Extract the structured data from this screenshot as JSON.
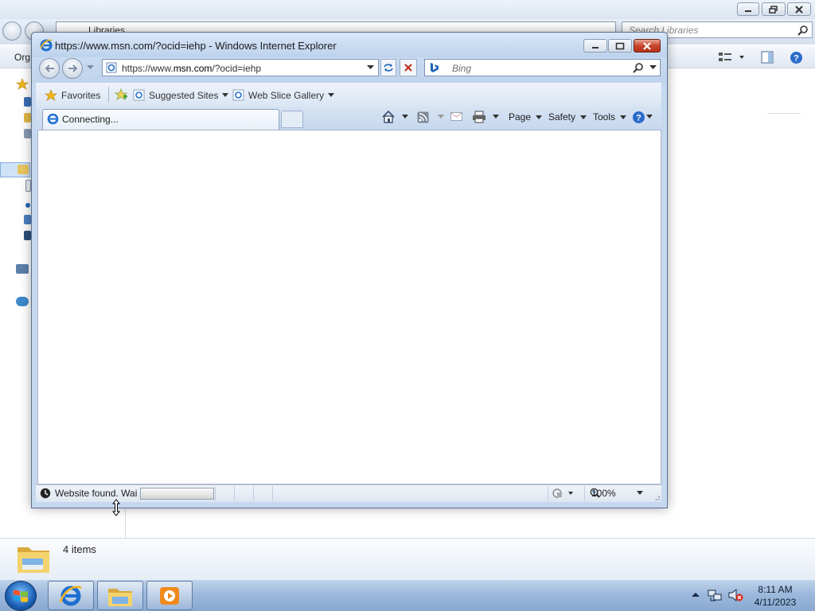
{
  "explorer": {
    "breadcrumb": "Libraries",
    "search_placeholder": "Search Libraries",
    "organize_label": "Org",
    "status_items": "4 items"
  },
  "ie": {
    "window_title": "https://www.msn.com/?ocid=iehp - Windows Internet Explorer",
    "address_prefix": "https://www.",
    "address_domain": "msn.com",
    "address_suffix": "/?ocid=iehp",
    "search_placeholder": "Bing",
    "favorites": {
      "label": "Favorites",
      "suggested_sites": "Suggested Sites",
      "web_slice_gallery": "Web Slice Gallery"
    },
    "tab_title": "Connecting...",
    "commands": {
      "page": "Page",
      "safety": "Safety",
      "tools": "Tools"
    },
    "status_text": "Website found. Wai",
    "progress_fraction": 0.0,
    "zoom": "100%"
  },
  "taskbar": {
    "time": "8:11 AM",
    "date": "4/11/2023",
    "icons": [
      "start-orb-icon",
      "internet-explorer-icon",
      "windows-explorer-icon",
      "media-player-icon"
    ]
  },
  "colors": {
    "close_button": "#c9462c",
    "taskbar": "#9db9dc",
    "bing": "#1e62b9"
  }
}
